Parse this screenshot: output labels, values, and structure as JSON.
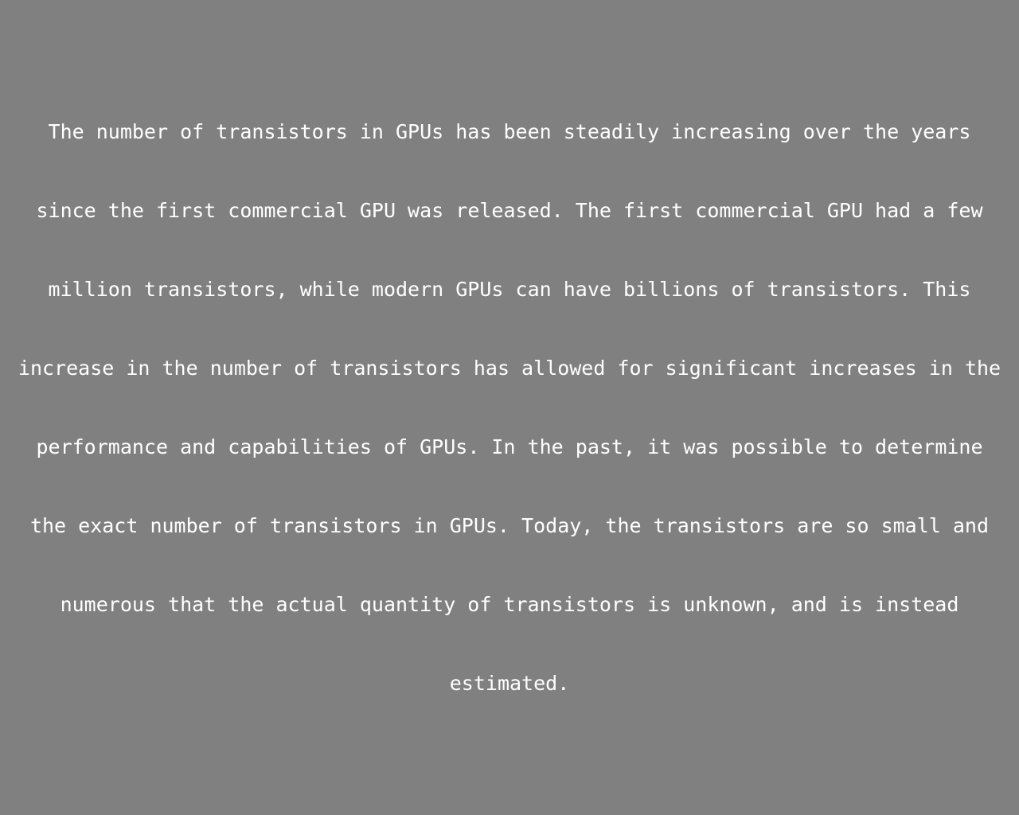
{
  "document": {
    "background_color": "#808080",
    "text_color": "#ffffff",
    "lines": [
      "The number of transistors in GPUs has been steadily increasing over the years",
      "since the first commercial GPU was released. The first commercial GPU had a few",
      "million transistors, while modern GPUs can have billions of transistors. This",
      "increase in the number of transistors has allowed for significant increases in the",
      "performance and capabilities of GPUs. In the past, it was possible to determine",
      "the exact number of transistors in GPUs. Today, the transistors are so small and",
      "numerous that the actual quantity of transistors is unknown, and is instead",
      "estimated."
    ]
  }
}
